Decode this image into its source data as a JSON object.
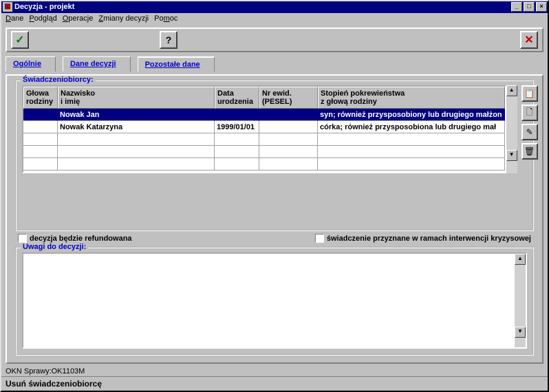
{
  "window": {
    "title": "Decyzja - projekt"
  },
  "menu": {
    "dane": "Dane",
    "podglad": "Podgląd",
    "operacje": "Operacje",
    "zmiany": "Zmiany decyzji",
    "pomoc": "Pomoc"
  },
  "tabs": {
    "ogolnie": "Ogólnie",
    "dane_decyzji": "Dane decyzji",
    "pozostale": "Pozostałe dane"
  },
  "group1_legend": "Świadczeniobiorcy:",
  "table": {
    "headers": {
      "glowa1": "Głowa",
      "glowa2": "rodziny",
      "nazw1": "Nazwisko",
      "nazw2": "i imię",
      "data1": "Data",
      "data2": "urodzenia",
      "pesel1": "Nr ewid.",
      "pesel2": "(PESEL)",
      "stop1": "Stopień pokrewieństwa",
      "stop2": "z głową rodziny"
    },
    "rows": [
      {
        "glowa": "",
        "nazw": "Nowak Jan",
        "data": "",
        "pesel": "",
        "stop": "syn; również przysposobiony lub drugiego małżon",
        "selected": true
      },
      {
        "glowa": "",
        "nazw": "Nowak Katarzyna",
        "data": "1999/01/01",
        "pesel": "",
        "stop": "córka; również przysposobiona lub drugiego mał",
        "selected": false
      }
    ]
  },
  "checks": {
    "refund": "decyzja będzie refundowana",
    "interw": "świadczenie przyznane w ramach interwencji kryzysowej"
  },
  "group2_legend": "Uwagi do decyzji:",
  "status_okn": "OKN Sprawy:OK1103M",
  "status_bar": "Usuń świadczeniobiorcę"
}
